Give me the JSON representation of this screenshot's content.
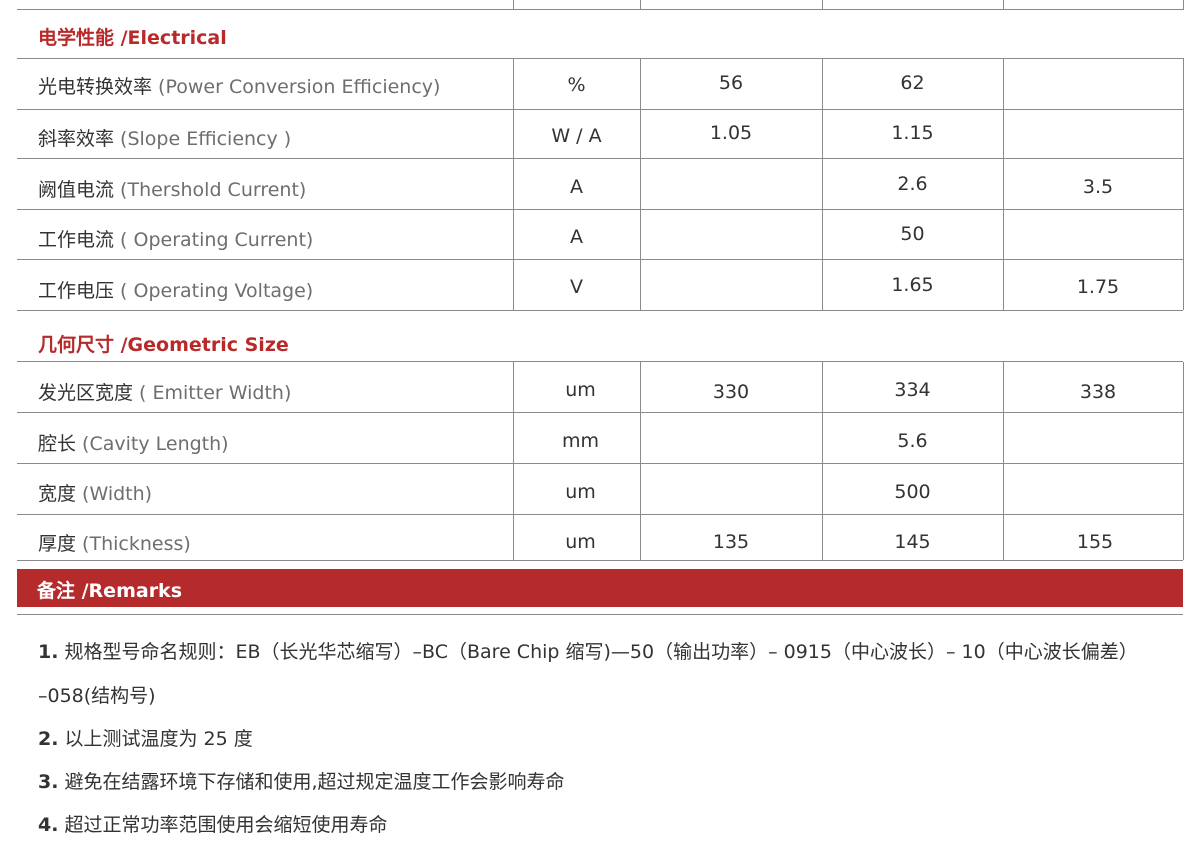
{
  "sections": {
    "electrical": "电学性能 /Electrical",
    "geometric": "几何尺寸 /Geometric Size",
    "remarks": "备注 /Remarks"
  },
  "electrical_rows": [
    {
      "cn": "光电转换效率",
      "en": " (Power Conversion Efficiency)",
      "unit": "%",
      "min": "56",
      "typ": "62",
      "max": ""
    },
    {
      "cn": "斜率效率",
      "en": " (Slope Efficiency )",
      "unit": "W / A",
      "min": "1.05",
      "typ": "1.15",
      "max": ""
    },
    {
      "cn": "阙值电流",
      "en": " (Thershold Current)",
      "unit": "A",
      "min": "",
      "typ": "2.6",
      "max": "3.5"
    },
    {
      "cn": "工作电流",
      "en": " ( Operating Current)",
      "unit": "A",
      "min": "",
      "typ": "50",
      "max": ""
    },
    {
      "cn": "工作电压",
      "en": " ( Operating Voltage)",
      "unit": "V",
      "min": "",
      "typ": "1.65",
      "max": "1.75"
    }
  ],
  "geometric_rows": [
    {
      "cn": "发光区宽度",
      "en": " ( Emitter Width)",
      "unit": "um",
      "min": "330",
      "typ": "334",
      "max": "338"
    },
    {
      "cn": "腔长",
      "en": " (Cavity Length)",
      "unit": "mm",
      "min": "",
      "typ": "5.6",
      "max": ""
    },
    {
      "cn": "宽度",
      "en": " (Width)",
      "unit": "um",
      "min": "",
      "typ": "500",
      "max": ""
    },
    {
      "cn": "厚度",
      "en": " (Thickness)",
      "unit": "um",
      "min": "135",
      "typ": "145",
      "max": "155"
    }
  ],
  "notes": [
    {
      "num": "1.",
      "text": " 规格型号命名规则：EB（长光华芯缩写）–BC（Bare Chip 缩写)—50（输出功率）– 0915（中心波长）– 10（中心波长偏差）"
    },
    {
      "num": "",
      "text": "–058(结构号)"
    },
    {
      "num": "2.",
      "text": " 以上测试温度为 25 度"
    },
    {
      "num": "3.",
      "text": " 避免在结露环境下存储和使用,超过规定温度工作会影响寿命"
    },
    {
      "num": "4.",
      "text": " 超过正常功率范围使用会缩短使用寿命"
    }
  ]
}
